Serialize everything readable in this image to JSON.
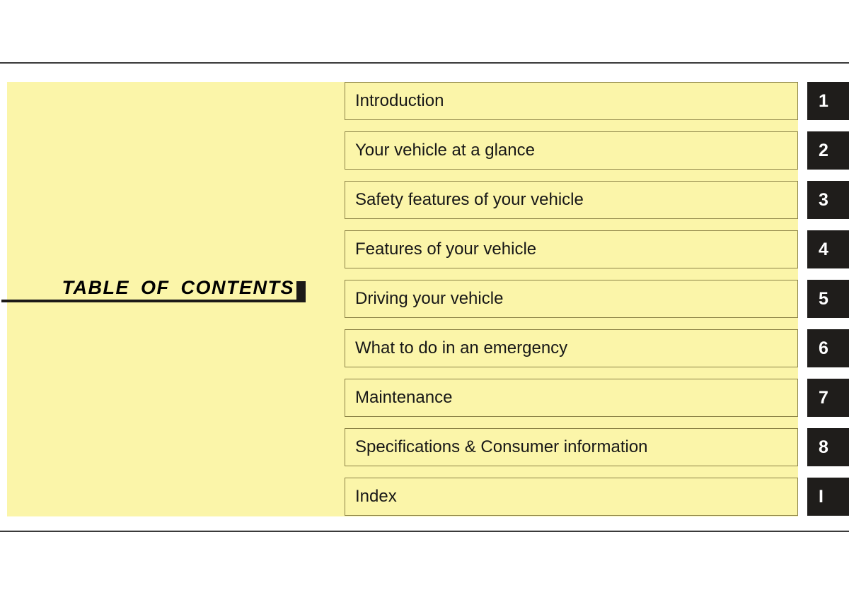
{
  "page": {
    "title": "TABLE  OF  CONTENTS",
    "background_color": "#ffffff",
    "panel_color": "#fbf5a9",
    "tab_color": "#1f1d1b",
    "rule_color": "#3a3a3a",
    "box_border_color": "#8c8347",
    "text_color": "#171717"
  },
  "contents": {
    "heading": "TABLE  OF  CONTENTS",
    "rows": [
      {
        "label": "Introduction",
        "tab": "1"
      },
      {
        "label": "Your vehicle at a glance",
        "tab": "2"
      },
      {
        "label": "Safety features of your vehicle",
        "tab": "3"
      },
      {
        "label": "Features of your vehicle",
        "tab": "4"
      },
      {
        "label": "Driving your vehicle",
        "tab": "5"
      },
      {
        "label": "What to do in an emergency",
        "tab": "6"
      },
      {
        "label": "Maintenance",
        "tab": "7"
      },
      {
        "label": "Specifications & Consumer information",
        "tab": "8"
      },
      {
        "label": "Index",
        "tab": "I"
      }
    ]
  }
}
